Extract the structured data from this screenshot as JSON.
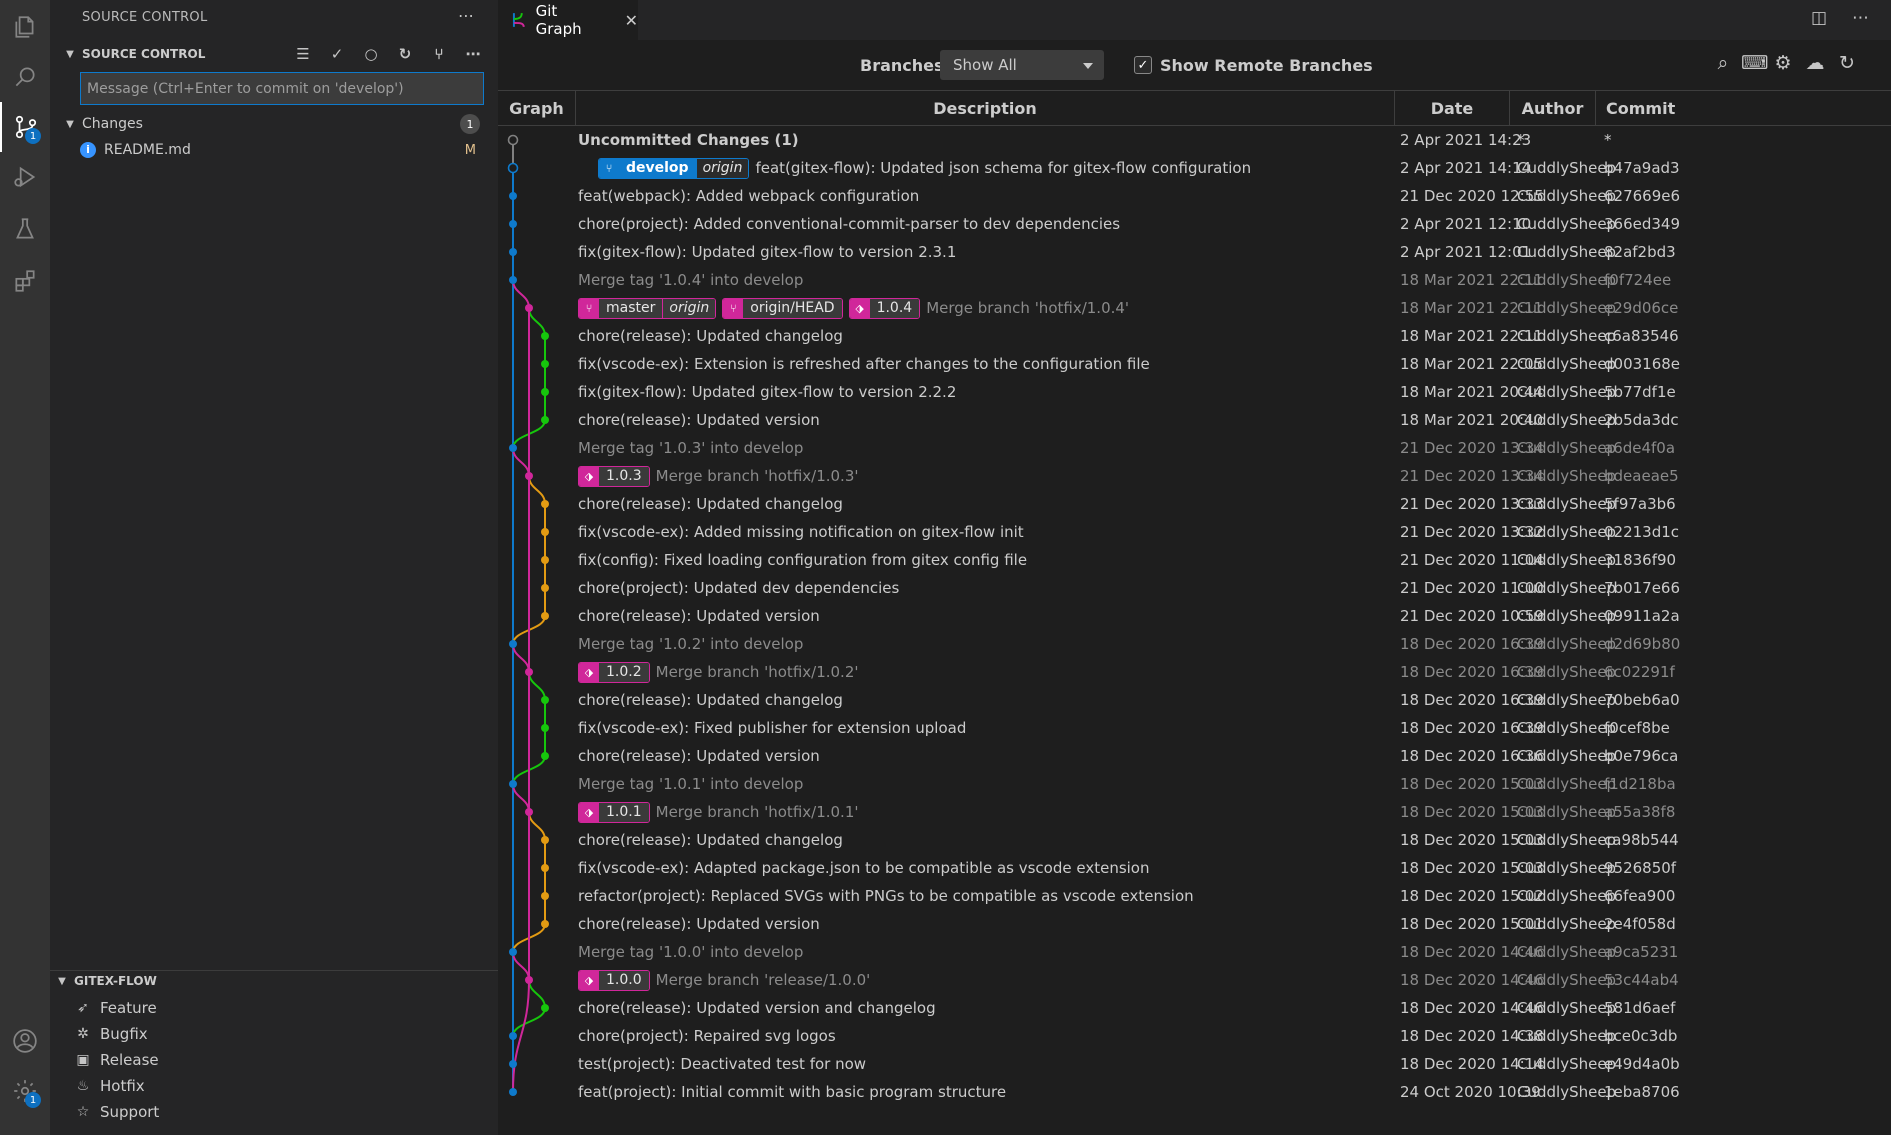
{
  "activity": {
    "source_control_badge": "1",
    "settings_badge": "1"
  },
  "sidebar": {
    "title": "SOURCE CONTROL",
    "section_title": "SOURCE CONTROL",
    "commit_placeholder": "Message (Ctrl+Enter to commit on 'develop')",
    "changes_label": "Changes",
    "changes_count": "1",
    "files": [
      {
        "name": "README.md",
        "status": "M"
      }
    ],
    "gitflow_title": "GITEX-FLOW",
    "gitflow_items": [
      "Feature",
      "Bugfix",
      "Release",
      "Hotfix",
      "Support"
    ]
  },
  "tab": {
    "title": "Git Graph"
  },
  "controls": {
    "branches_label": "Branches:",
    "branches_value": "Show All",
    "show_remote_label": "Show Remote Branches",
    "show_remote_checked": true
  },
  "table": {
    "headers": {
      "graph": "Graph",
      "description": "Description",
      "date": "Date",
      "author": "Author",
      "commit": "Commit"
    },
    "rows": [
      {
        "desc": "Uncommitted Changes (1)",
        "date": "2 Apr 2021 14:23",
        "author": "*",
        "hash": "*",
        "style": "bold",
        "refs": []
      },
      {
        "desc": "feat(gitex-flow): Updated json schema for gitex-flow configuration",
        "date": "2 Apr 2021 14:14",
        "author": "CuddlySheep",
        "hash": "b47a9ad3",
        "style": "",
        "refs": [
          {
            "name": "develop",
            "origin": "origin",
            "color": "blue"
          }
        ]
      },
      {
        "desc": "feat(webpack): Added webpack configuration",
        "date": "21 Dec 2020 12:55",
        "author": "CuddlySheep",
        "hash": "627669e6",
        "style": "",
        "refs": []
      },
      {
        "desc": "chore(project): Added conventional-commit-parser to dev dependencies",
        "date": "2 Apr 2021 12:10",
        "author": "CuddlySheep",
        "hash": "366ed349",
        "style": "",
        "refs": []
      },
      {
        "desc": "fix(gitex-flow): Updated gitex-flow to version 2.3.1",
        "date": "2 Apr 2021 12:01",
        "author": "CuddlySheep",
        "hash": "82af2bd3",
        "style": "",
        "refs": []
      },
      {
        "desc": "Merge tag '1.0.4' into develop",
        "date": "18 Mar 2021 22:11",
        "author": "CuddlySheep",
        "hash": "f0f724ee",
        "style": "dim",
        "refs": []
      },
      {
        "desc": "Merge branch 'hotfix/1.0.4'",
        "date": "18 Mar 2021 22:11",
        "author": "CuddlySheep",
        "hash": "e29d06ce",
        "style": "dim",
        "refs": [
          {
            "name": "master",
            "origin": "origin",
            "color": "pink"
          },
          {
            "name": "origin/HEAD",
            "origin": "",
            "color": "pink"
          },
          {
            "name": "1.0.4",
            "origin": "",
            "color": "pink",
            "tag": true
          }
        ]
      },
      {
        "desc": "chore(release): Updated changelog",
        "date": "18 Mar 2021 22:11",
        "author": "CuddlySheep",
        "hash": "c6a83546",
        "style": "",
        "refs": []
      },
      {
        "desc": "fix(vscode-ex): Extension is refreshed after changes to the configuration file",
        "date": "18 Mar 2021 22:05",
        "author": "CuddlySheep",
        "hash": "d003168e",
        "style": "",
        "refs": []
      },
      {
        "desc": "fix(gitex-flow): Updated gitex-flow to version 2.2.2",
        "date": "18 Mar 2021 20:44",
        "author": "CuddlySheep",
        "hash": "5b77df1e",
        "style": "",
        "refs": []
      },
      {
        "desc": "chore(release): Updated version",
        "date": "18 Mar 2021 20:40",
        "author": "CuddlySheep",
        "hash": "2b5da3dc",
        "style": "",
        "refs": []
      },
      {
        "desc": "Merge tag '1.0.3' into develop",
        "date": "21 Dec 2020 13:34",
        "author": "CuddlySheep",
        "hash": "a6de4f0a",
        "style": "dim",
        "refs": []
      },
      {
        "desc": "Merge branch 'hotfix/1.0.3'",
        "date": "21 Dec 2020 13:34",
        "author": "CuddlySheep",
        "hash": "bdeaeae5",
        "style": "dim",
        "refs": [
          {
            "name": "1.0.3",
            "origin": "",
            "color": "pink",
            "tag": true
          }
        ]
      },
      {
        "desc": "chore(release): Updated changelog",
        "date": "21 Dec 2020 13:33",
        "author": "CuddlySheep",
        "hash": "5f97a3b6",
        "style": "",
        "refs": []
      },
      {
        "desc": "fix(vscode-ex): Added missing notification on gitex-flow init",
        "date": "21 Dec 2020 13:32",
        "author": "CuddlySheep",
        "hash": "02213d1c",
        "style": "",
        "refs": []
      },
      {
        "desc": "fix(config): Fixed loading configuration from gitex config file",
        "date": "21 Dec 2020 11:04",
        "author": "CuddlySheep",
        "hash": "31836f90",
        "style": "",
        "refs": []
      },
      {
        "desc": "chore(project): Updated dev dependencies",
        "date": "21 Dec 2020 11:00",
        "author": "CuddlySheep",
        "hash": "7b017e66",
        "style": "",
        "refs": []
      },
      {
        "desc": "chore(release): Updated version",
        "date": "21 Dec 2020 10:59",
        "author": "CuddlySheep",
        "hash": "09911a2a",
        "style": "",
        "refs": []
      },
      {
        "desc": "Merge tag '1.0.2' into develop",
        "date": "18 Dec 2020 16:39",
        "author": "CuddlySheep",
        "hash": "d2d69b80",
        "style": "dim",
        "refs": []
      },
      {
        "desc": "Merge branch 'hotfix/1.0.2'",
        "date": "18 Dec 2020 16:39",
        "author": "CuddlySheep",
        "hash": "6c02291f",
        "style": "dim",
        "refs": [
          {
            "name": "1.0.2",
            "origin": "",
            "color": "pink",
            "tag": true
          }
        ]
      },
      {
        "desc": "chore(release): Updated changelog",
        "date": "18 Dec 2020 16:39",
        "author": "CuddlySheep",
        "hash": "70beb6a0",
        "style": "",
        "refs": []
      },
      {
        "desc": "fix(vscode-ex): Fixed publisher for extension upload",
        "date": "18 Dec 2020 16:39",
        "author": "CuddlySheep",
        "hash": "f0cef8be",
        "style": "",
        "refs": []
      },
      {
        "desc": "chore(release): Updated version",
        "date": "18 Dec 2020 16:36",
        "author": "CuddlySheep",
        "hash": "b0e796ca",
        "style": "",
        "refs": []
      },
      {
        "desc": "Merge tag '1.0.1' into develop",
        "date": "18 Dec 2020 15:03",
        "author": "CuddlySheep",
        "hash": "f1d218ba",
        "style": "dim",
        "refs": []
      },
      {
        "desc": "Merge branch 'hotfix/1.0.1'",
        "date": "18 Dec 2020 15:03",
        "author": "CuddlySheep",
        "hash": "a55a38f8",
        "style": "dim",
        "refs": [
          {
            "name": "1.0.1",
            "origin": "",
            "color": "pink",
            "tag": true
          }
        ]
      },
      {
        "desc": "chore(release): Updated changelog",
        "date": "18 Dec 2020 15:03",
        "author": "CuddlySheep",
        "hash": "ca98b544",
        "style": "",
        "refs": []
      },
      {
        "desc": "fix(vscode-ex): Adapted package.json to be compatible as vscode extension",
        "date": "18 Dec 2020 15:03",
        "author": "CuddlySheep",
        "hash": "9526850f",
        "style": "",
        "refs": []
      },
      {
        "desc": "refactor(project): Replaced SVGs with PNGs to be compatible as vscode extension",
        "date": "18 Dec 2020 15:02",
        "author": "CuddlySheep",
        "hash": "66fea900",
        "style": "",
        "refs": []
      },
      {
        "desc": "chore(release): Updated version",
        "date": "18 Dec 2020 15:01",
        "author": "CuddlySheep",
        "hash": "2e4f058d",
        "style": "",
        "refs": []
      },
      {
        "desc": "Merge tag '1.0.0' into develop",
        "date": "18 Dec 2020 14:46",
        "author": "CuddlySheep",
        "hash": "a9ca5231",
        "style": "dim",
        "refs": []
      },
      {
        "desc": "Merge branch 'release/1.0.0'",
        "date": "18 Dec 2020 14:46",
        "author": "CuddlySheep",
        "hash": "53c44ab4",
        "style": "dim",
        "refs": [
          {
            "name": "1.0.0",
            "origin": "",
            "color": "pink",
            "tag": true
          }
        ]
      },
      {
        "desc": "chore(release): Updated version and changelog",
        "date": "18 Dec 2020 14:46",
        "author": "CuddlySheep",
        "hash": "581d6aef",
        "style": "",
        "refs": []
      },
      {
        "desc": "chore(project): Repaired svg logos",
        "date": "18 Dec 2020 14:38",
        "author": "CuddlySheep",
        "hash": "bce0c3db",
        "style": "",
        "refs": []
      },
      {
        "desc": "test(project): Deactivated test for now",
        "date": "18 Dec 2020 14:14",
        "author": "CuddlySheep",
        "hash": "e49d4a0b",
        "style": "",
        "refs": []
      },
      {
        "desc": "feat(project): Initial commit with basic program structure",
        "date": "24 Oct 2020 10:39",
        "author": "CuddlySheep",
        "hash": "1eba8706",
        "style": "",
        "refs": []
      }
    ]
  },
  "colors": {
    "develop": "#0e7acc",
    "master": "#d0279a",
    "branch_green": "#16c60c",
    "branch_orange": "#e39b13",
    "uncommitted": "#808080"
  }
}
